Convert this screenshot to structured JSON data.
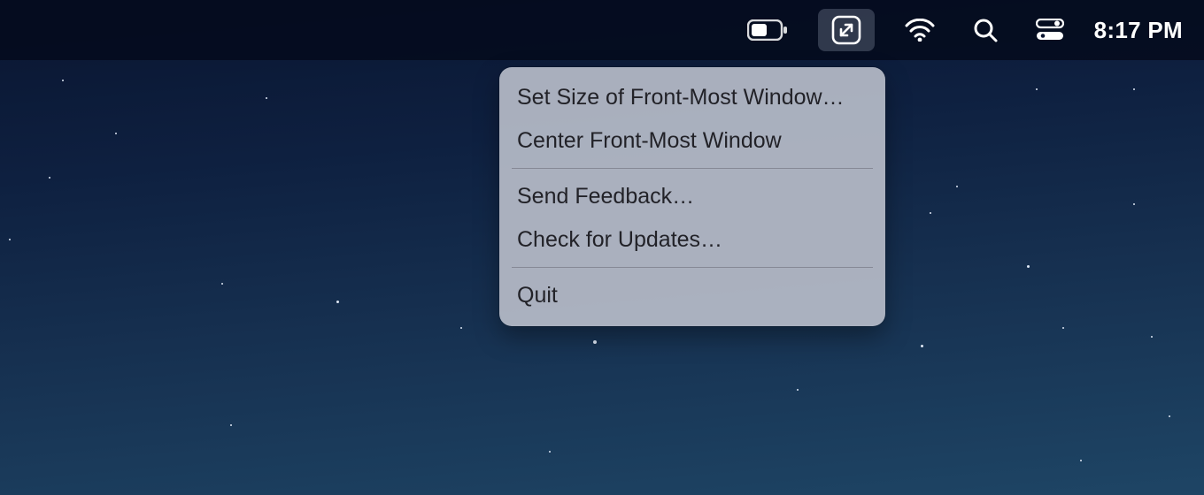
{
  "menubar": {
    "clock": "8:17 PM"
  },
  "dropdown": {
    "items": [
      "Set Size of Front-Most Window…",
      "Center Front-Most Window",
      "Send Feedback…",
      "Check for Updates…",
      "Quit"
    ]
  }
}
